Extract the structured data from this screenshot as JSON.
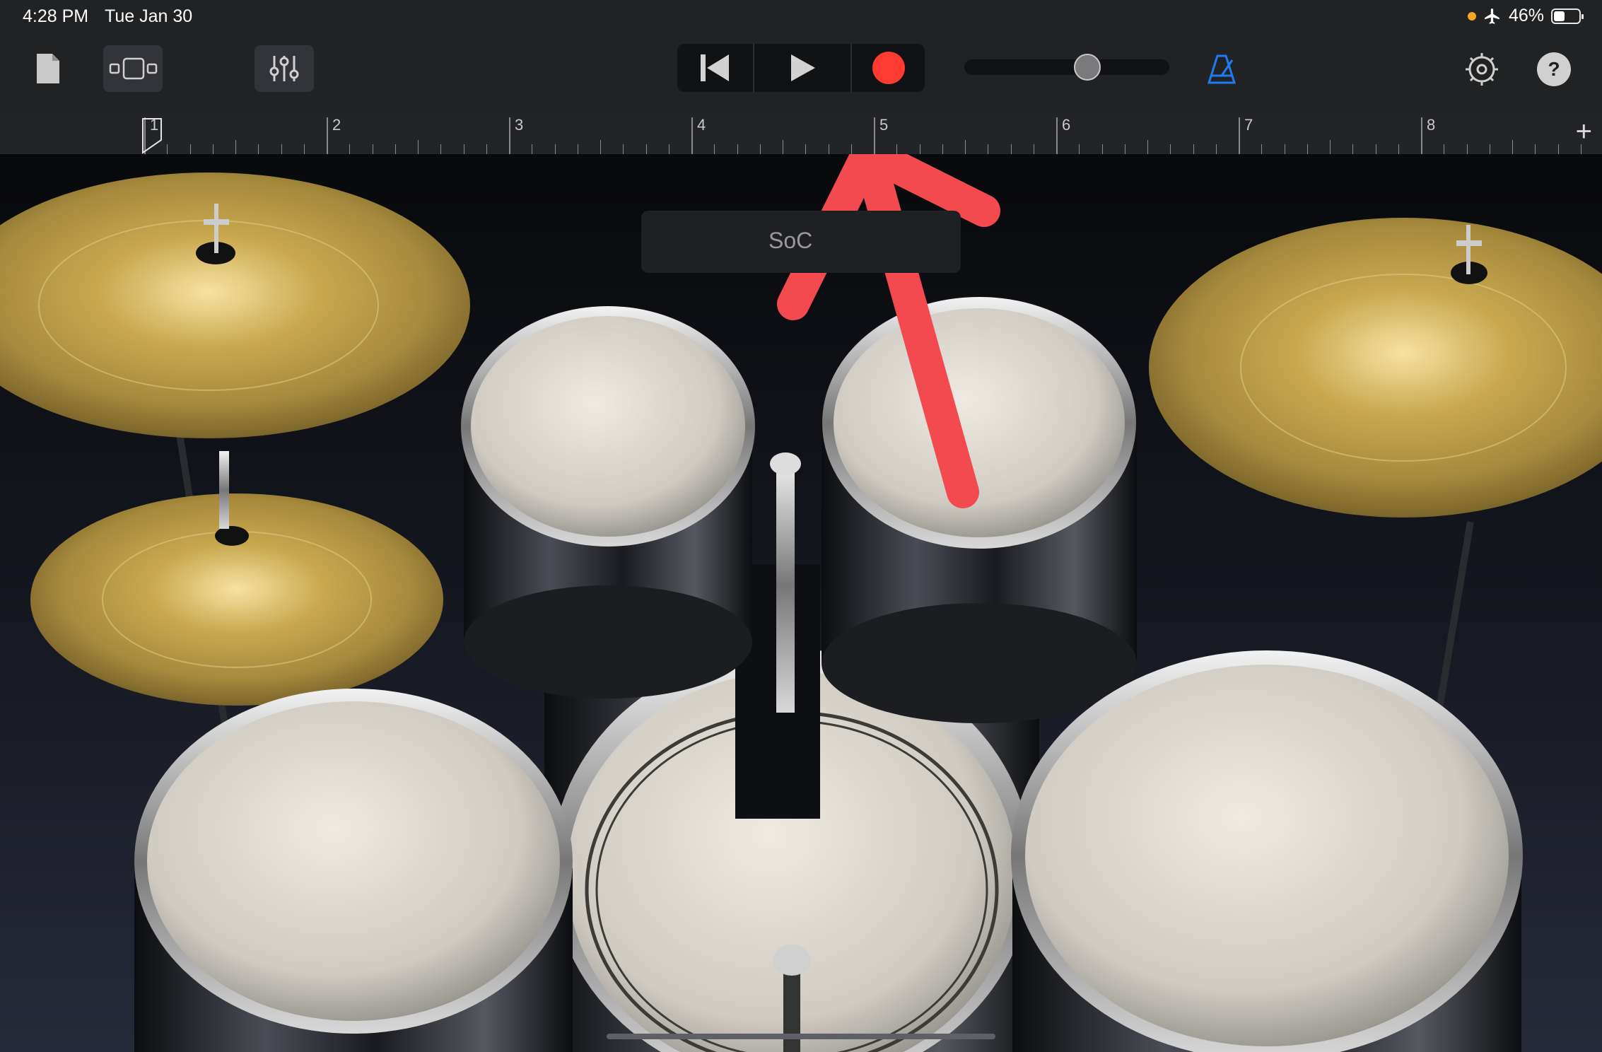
{
  "status_bar": {
    "time": "4:28 PM",
    "date": "Tue Jan 30",
    "battery": "46%",
    "airplane_icon": "airplane-icon"
  },
  "toolbar": {
    "icons": [
      "document-icon",
      "view-toggle-icon",
      "mixer-icon",
      "rewind-icon",
      "play-icon",
      "record-icon",
      "metronome-icon",
      "settings-icon",
      "help-icon"
    ],
    "help_label": "?",
    "accent_color": "#1e7cf2",
    "record_color": "#fe3b30"
  },
  "ruler": {
    "bars": [
      "1",
      "2",
      "3",
      "4",
      "5",
      "6",
      "7",
      "8"
    ],
    "add_label": "+"
  },
  "master_volume": {
    "level": 0.6
  },
  "song_selector": {
    "label": "SoC"
  },
  "drum_kit": {
    "pieces": [
      "crash-cymbal",
      "hi-hat",
      "ride-cymbal",
      "tom-1",
      "tom-2",
      "kick-drum",
      "floor-tom-left",
      "floor-tom-right"
    ]
  },
  "annotation": {
    "color": "#f24a4f"
  }
}
